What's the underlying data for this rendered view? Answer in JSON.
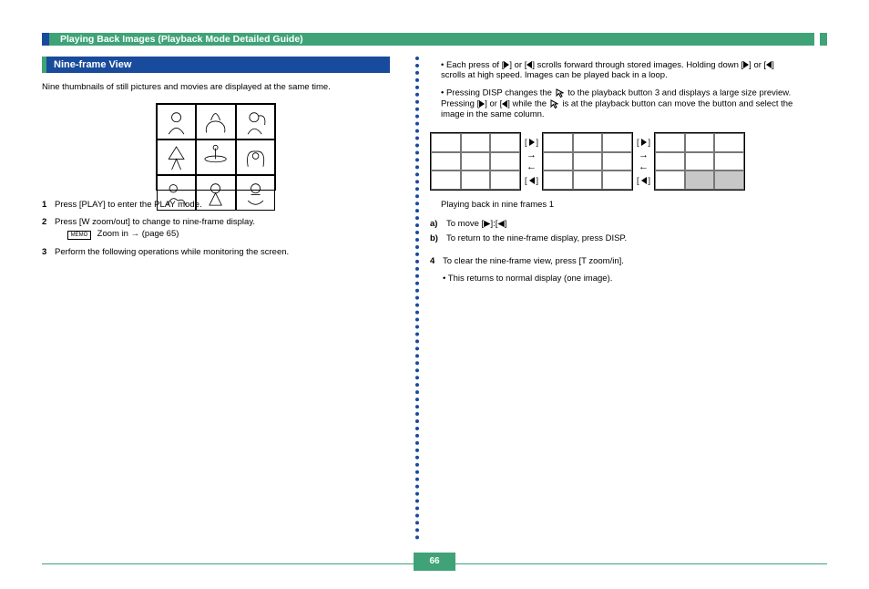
{
  "header": {
    "title": "Playing Back Images (Playback Mode Detailed Guide)"
  },
  "section": {
    "title": "Nine-frame View"
  },
  "left": {
    "intro": "Nine thumbnails of still pictures and movies are displayed at the same time.",
    "steps": [
      {
        "num": "1",
        "text": "Press [PLAY] to enter the PLAY mode."
      },
      {
        "num": "2",
        "text": "Press [W zoom/out] to change to nine-frame display.",
        "ref1_prefix": "Zoom in →",
        "ref1": "(page 65)"
      },
      {
        "num": "3",
        "text": "Perform the following operations while monitoring the screen."
      }
    ]
  },
  "right": {
    "para1_prefix": "• Each press of [",
    "para1_mid1": "] or [",
    "para1_mid2": "] scrolls forward through stored images. Holding down [",
    "para1_mid3": "] or [",
    "para1_suffix": "] scrolls at high speed. Images can be played back in a loop.",
    "para2_prefix": "• Pressing DISP changes the ",
    "para2_mid": " to the playback button 3 and displays a large size preview. Pressing [",
    "para2_mid2": "] or [",
    "para2_mid3": "] while the ",
    "para2_suffix": " is at the playback button can move the button and select the image in the same column.",
    "grid_caption": "Playing back in nine frames 1",
    "sub_a_label": "a)",
    "sub_a": "To move [▶]:[◀]",
    "sub_b_label": "b)",
    "sub_b": "To return to the nine-frame display, press DISP.",
    "step4_num": "4",
    "step4": "To clear the nine-frame view, press [T zoom/in].",
    "note": "• This returns to normal display (one image)."
  },
  "icons": {
    "tri_right": "▶",
    "tri_left": "◀",
    "cursor": "↖",
    "arrow_right": "→",
    "arrow_left": "←",
    "memo": "MEMO"
  },
  "page_number": "66"
}
